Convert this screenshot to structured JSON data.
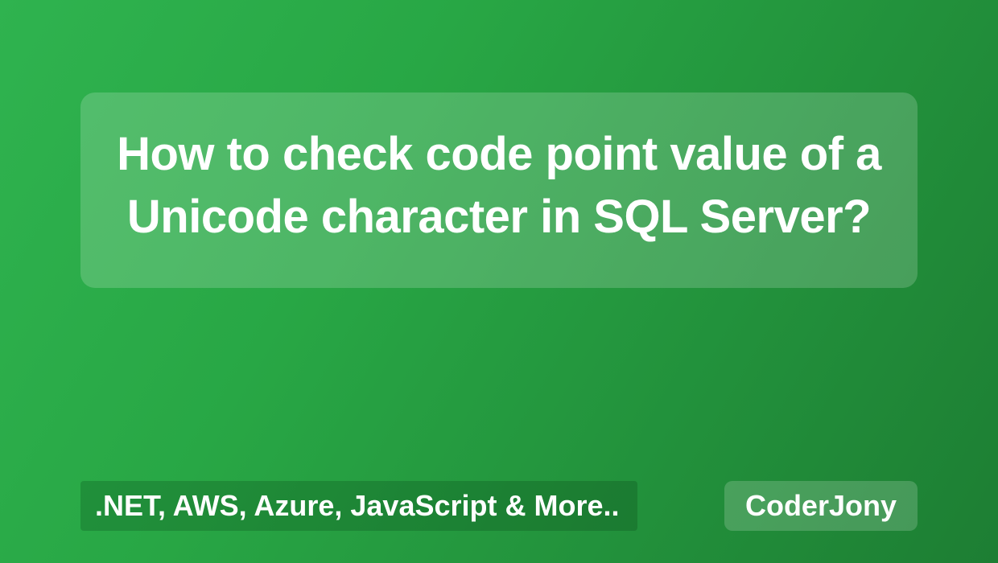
{
  "title": "How to check code point value of a Unicode character in SQL Server?",
  "tagline": ".NET, AWS, Azure, JavaScript & More..",
  "brand": "CoderJony"
}
